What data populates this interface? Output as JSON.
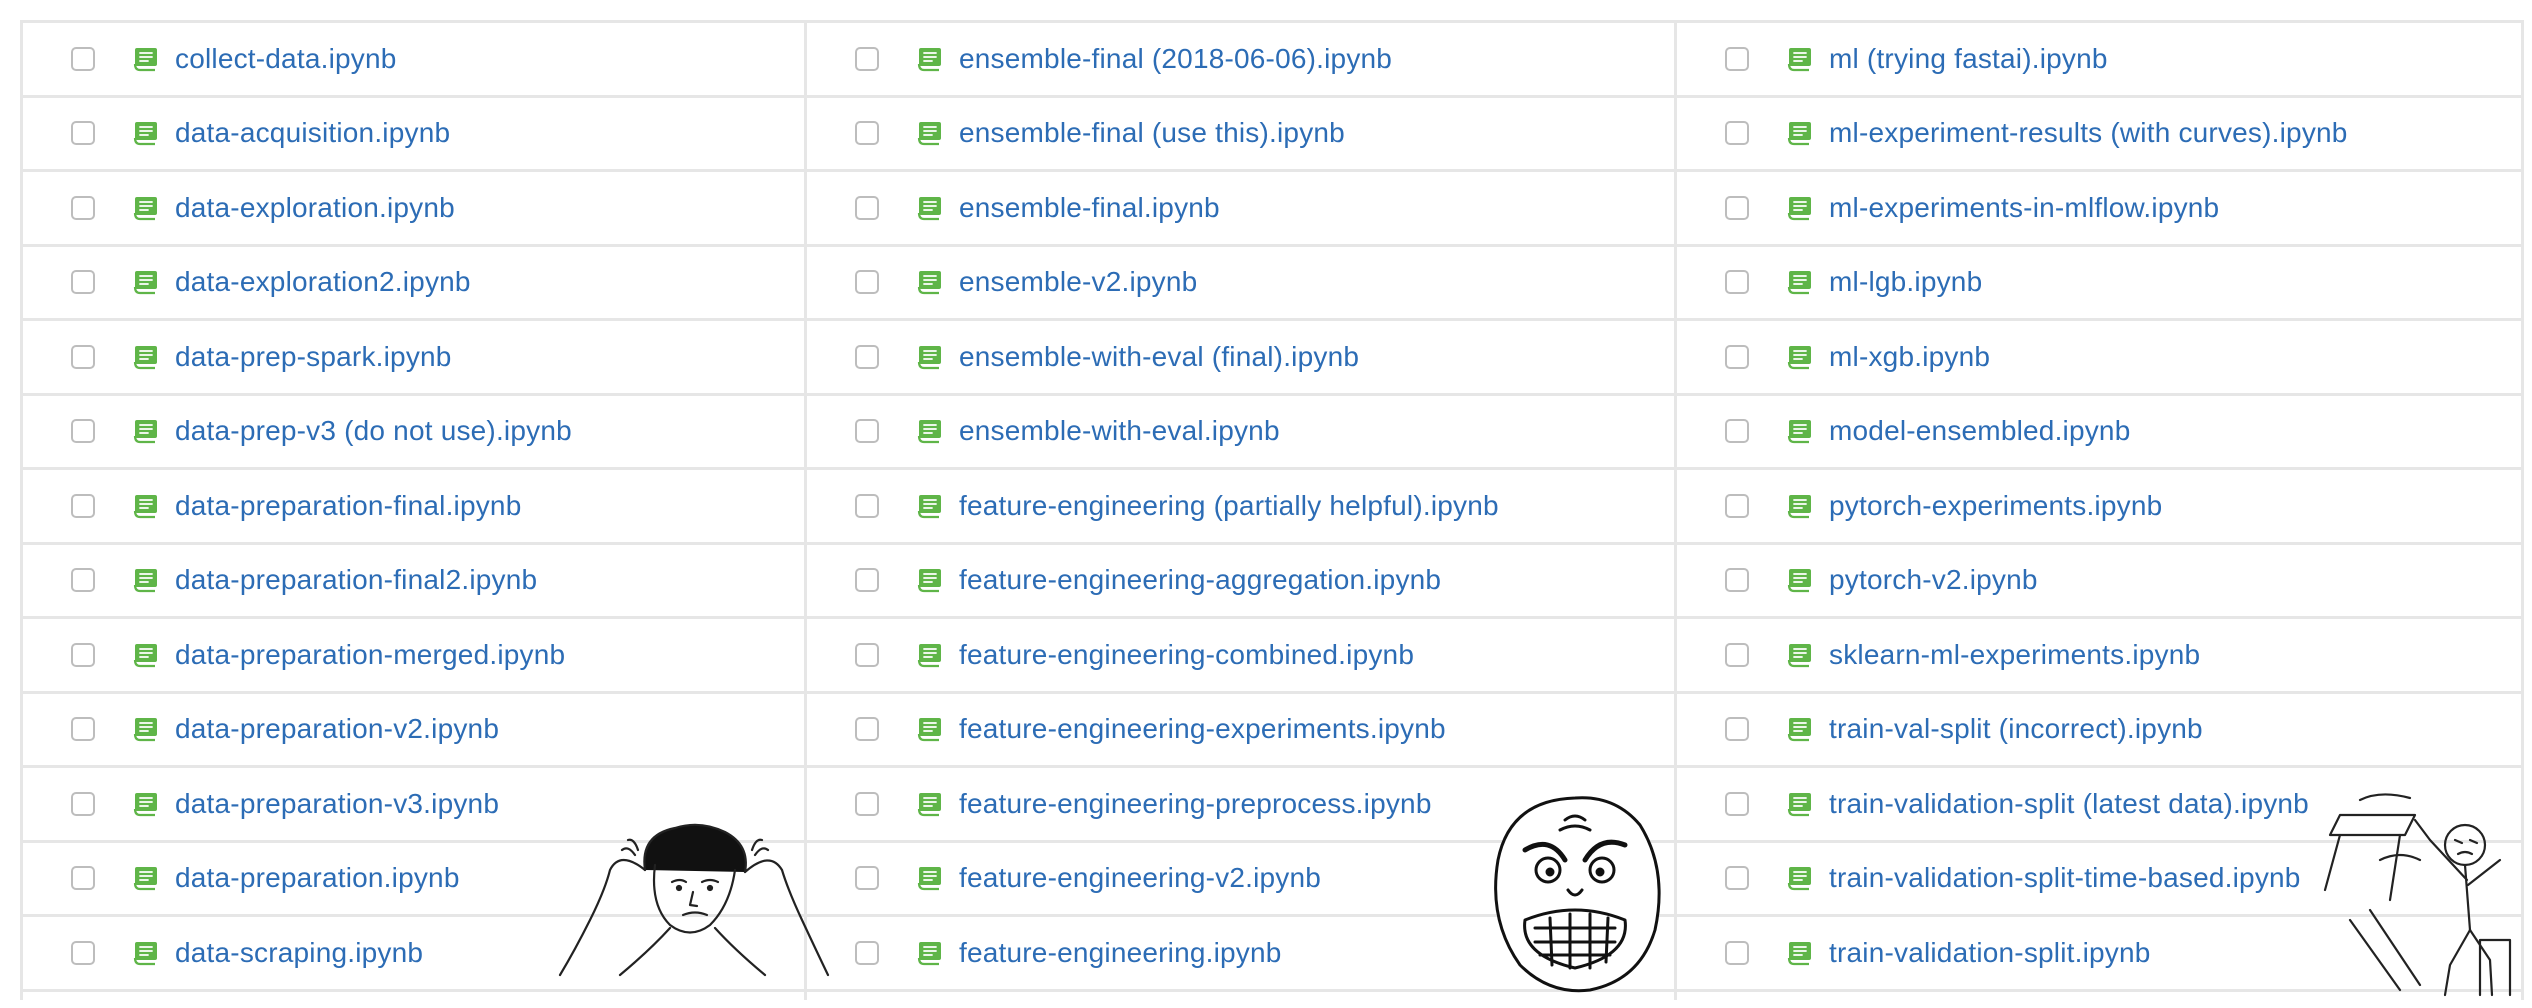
{
  "colors": {
    "link": "#2c6cb5",
    "notebook_icon": "#5fb548",
    "border": "#e6e6e6"
  },
  "columns": [
    {
      "files": [
        "collect-data.ipynb",
        "data-acquisition.ipynb",
        "data-exploration.ipynb",
        "data-exploration2.ipynb",
        "data-prep-spark.ipynb",
        "data-prep-v3 (do not use).ipynb",
        "data-preparation-final.ipynb",
        "data-preparation-final2.ipynb",
        "data-preparation-merged.ipynb",
        "data-preparation-v2.ipynb",
        "data-preparation-v3.ipynb",
        "data-preparation.ipynb",
        "data-scraping.ipynb"
      ]
    },
    {
      "files": [
        "ensemble-final (2018-06-06).ipynb",
        "ensemble-final (use this).ipynb",
        "ensemble-final.ipynb",
        "ensemble-v2.ipynb",
        "ensemble-with-eval (final).ipynb",
        "ensemble-with-eval.ipynb",
        "feature-engineering (partially helpful).ipynb",
        "feature-engineering-aggregation.ipynb",
        "feature-engineering-combined.ipynb",
        "feature-engineering-experiments.ipynb",
        "feature-engineering-preprocess.ipynb",
        "feature-engineering-v2.ipynb",
        "feature-engineering.ipynb"
      ]
    },
    {
      "files": [
        "ml (trying fastai).ipynb",
        "ml-experiment-results (with curves).ipynb",
        "ml-experiments-in-mlflow.ipynb",
        "ml-lgb.ipynb",
        "ml-xgb.ipynb",
        "model-ensembled.ipynb",
        "pytorch-experiments.ipynb",
        "pytorch-v2.ipynb",
        "sklearn-ml-experiments.ipynb",
        "train-val-split (incorrect).ipynb",
        "train-validation-split (latest data).ipynb",
        "train-validation-split-time-based.ipynb",
        "train-validation-split.ipynb"
      ]
    }
  ],
  "icons": {
    "file_icon": "notebook-icon",
    "memes": [
      "frustrated-man-sketch",
      "rage-face-sketch",
      "table-flip-sketch"
    ]
  }
}
